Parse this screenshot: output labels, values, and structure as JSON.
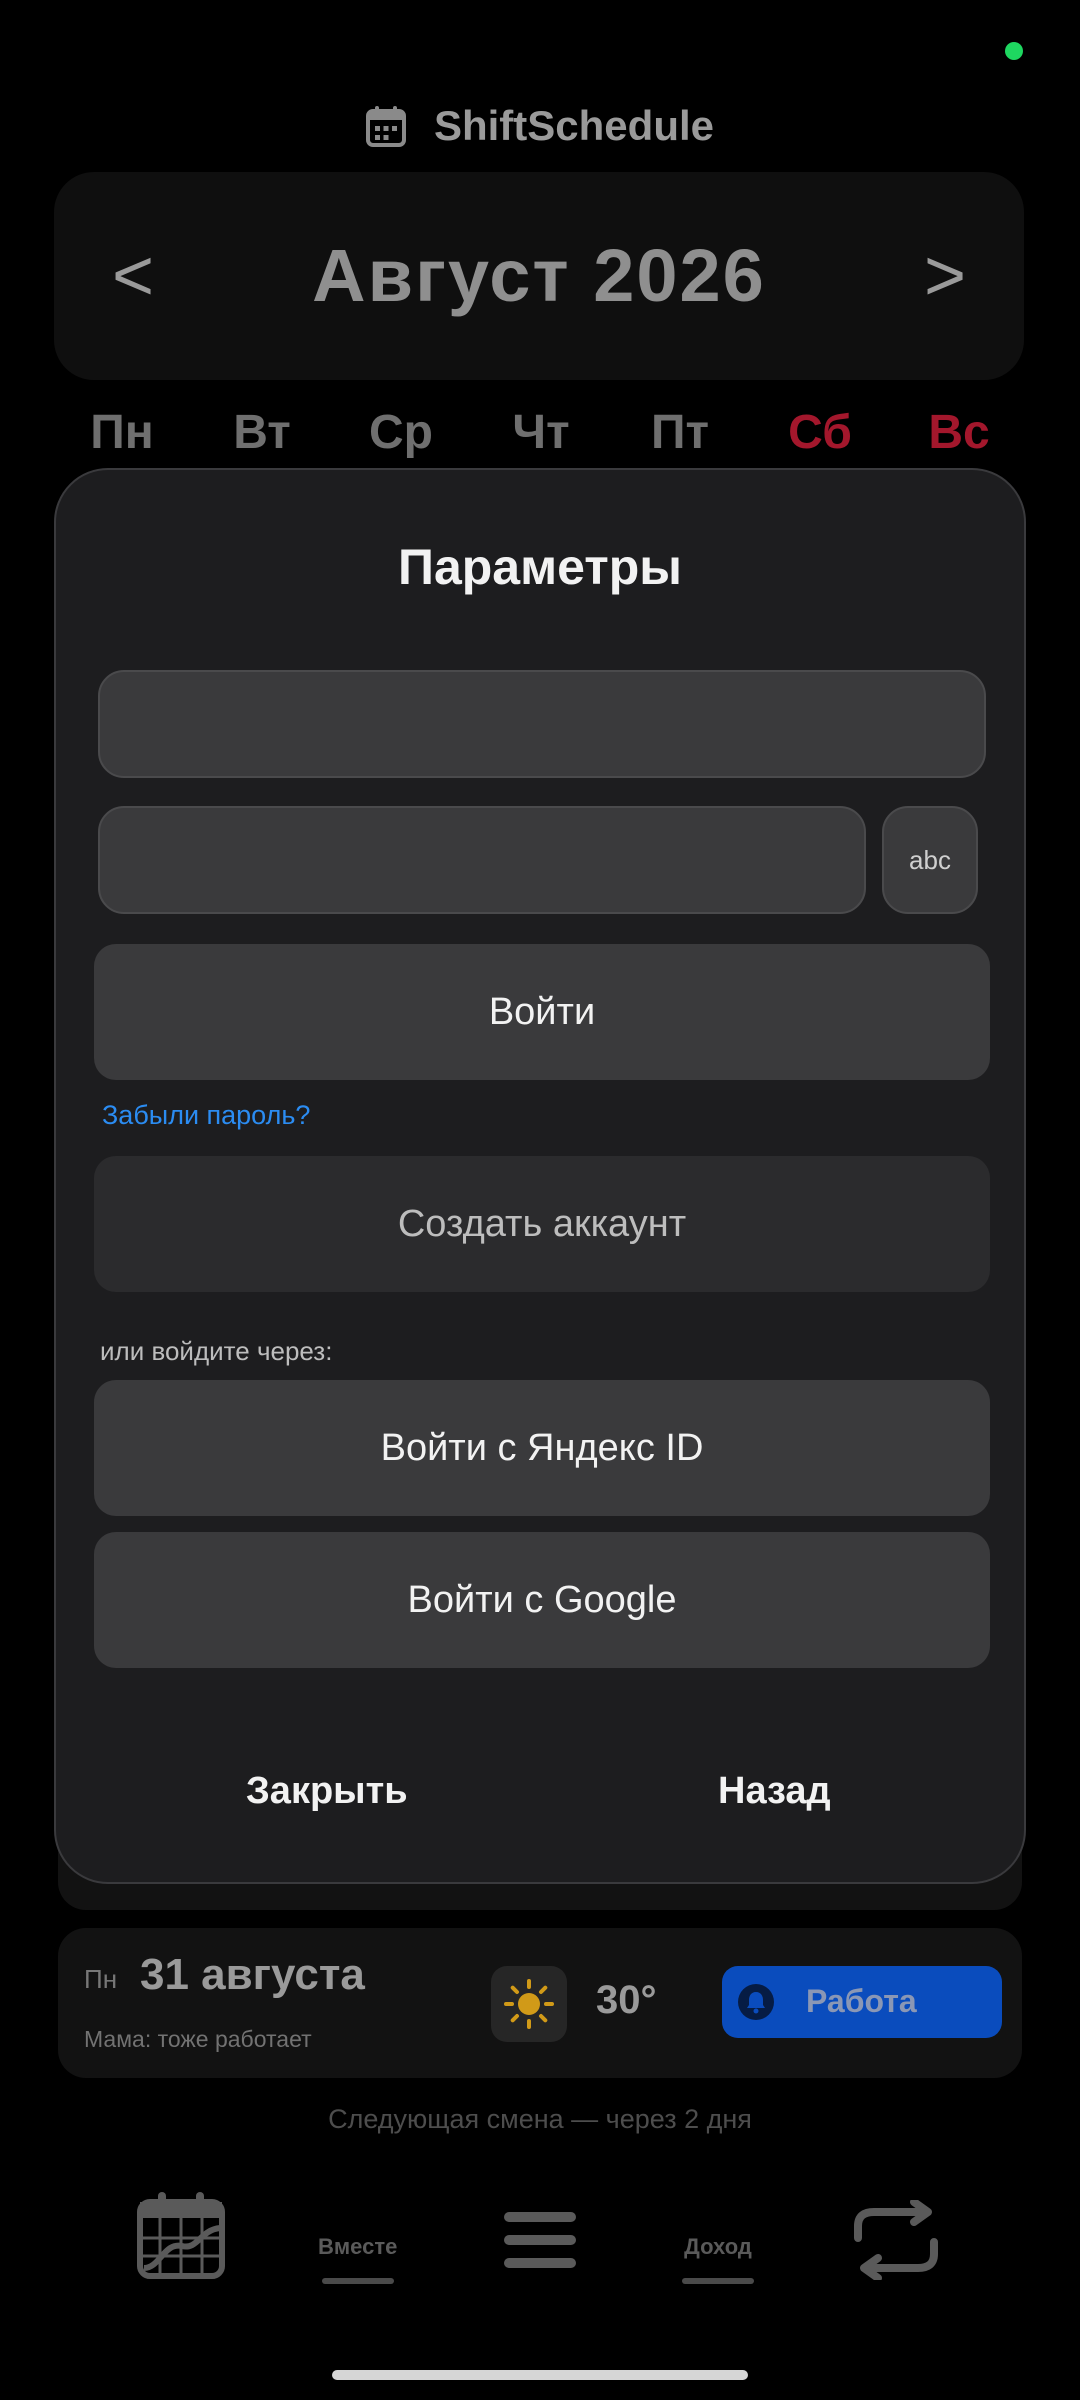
{
  "app": {
    "title": "ShiftSchedule"
  },
  "calendar": {
    "month_title": "Август 2026",
    "prev": "<",
    "next": ">",
    "weekdays": [
      "Пн",
      "Вт",
      "Ср",
      "Чт",
      "Пт",
      "Сб",
      "Вс"
    ]
  },
  "day_card": {
    "dow": "Пн",
    "date": "31 августа",
    "note": "Мама: тоже работает",
    "temperature": "30°",
    "status_label": "Работа"
  },
  "next_shift": "Следующая смена — через 2 дня",
  "bottom_nav": {
    "together_label": "Вместе",
    "income_label": "Доход"
  },
  "modal": {
    "title": "Параметры",
    "login_value": "",
    "password_value": "",
    "keyboard_toggle": "abc",
    "login_button": "Войти",
    "forgot_password": "Забыли пароль?",
    "create_account": "Создать аккаунт",
    "or_text": "или войдите через:",
    "yandex_button": "Войти с Яндекс ID",
    "google_button": "Войти с Google",
    "close_button": "Закрыть",
    "back_button": "Назад"
  },
  "colors": {
    "status_dot": "#1ed760",
    "weekend": "#a3172c",
    "link": "#2b8cf2",
    "work_button": "#0a4cbd"
  }
}
